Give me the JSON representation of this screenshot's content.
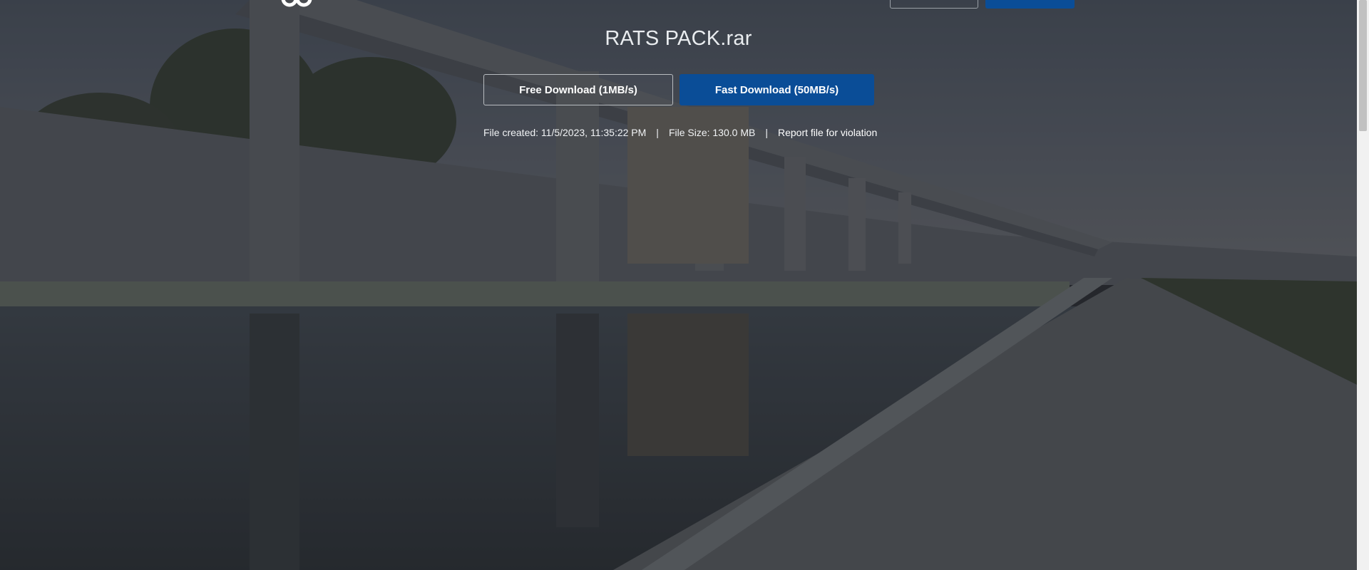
{
  "file": {
    "name": "RATS PACK.rar",
    "created_label": "File created: 11/5/2023, 11:35:22 PM",
    "size_label": "File Size: 130.0 MB",
    "separator": "|",
    "report_label": "Report file for violation"
  },
  "actions": {
    "free_download_label": "Free Download (1MB/s)",
    "fast_download_label": "Fast Download (50MB/s)"
  },
  "colors": {
    "primary": "#0a4d97",
    "overlay": "#202327"
  },
  "icons": {
    "logo": "brand-logo-icon"
  }
}
